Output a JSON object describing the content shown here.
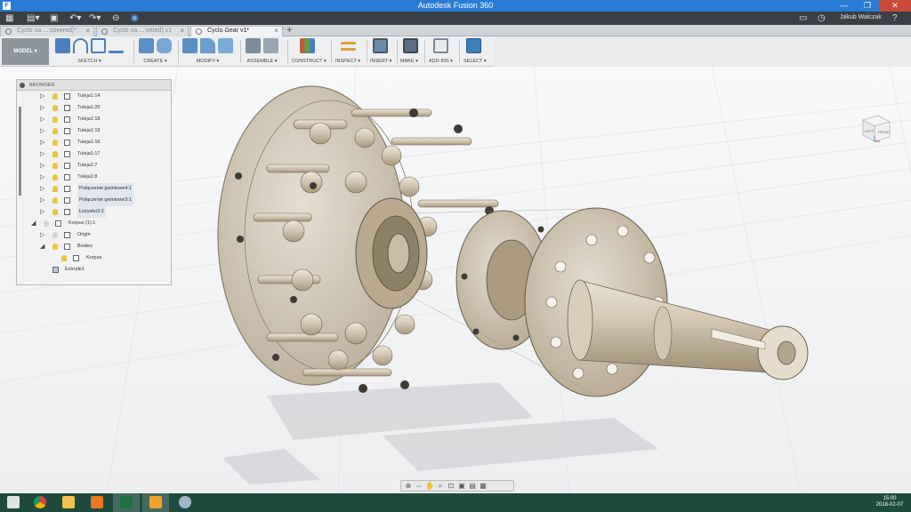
{
  "window": {
    "title": "Autodesk Fusion 360",
    "app_icon": "fusion-app-icon"
  },
  "quickbar": {
    "user": "Jakub Walczak",
    "icons": [
      "grid-icon",
      "file-icon",
      "save-icon",
      "undo-icon",
      "redo-icon",
      "sync-icon",
      "job-status-icon",
      "chat-icon",
      "clock-icon",
      "help-icon"
    ]
  },
  "tabs": [
    {
      "label": "Cyclo na ... covered)*",
      "active": false
    },
    {
      "label": "Cyclo na ... vered) v1",
      "active": false
    },
    {
      "label": "Cyclo Gear v1*",
      "active": true
    }
  ],
  "toolbar": {
    "workspace": "MODEL",
    "groups": [
      {
        "label": "SKETCH",
        "icons": [
          "sketch-icon",
          "arc-icon",
          "rectangle-icon",
          "line-icon"
        ]
      },
      {
        "label": "CREATE",
        "icons": [
          "extrude-icon",
          "revolve-icon"
        ]
      },
      {
        "label": "MODIFY",
        "icons": [
          "press-pull-icon",
          "fillet-icon",
          "chamfer-icon"
        ]
      },
      {
        "label": "ASSEMBLE",
        "icons": [
          "joint-icon",
          "component-icon"
        ]
      },
      {
        "label": "CONSTRUCT",
        "icons": [
          "plane-icon"
        ]
      },
      {
        "label": "INSPECT",
        "icons": [
          "measure-icon"
        ]
      },
      {
        "label": "INSERT",
        "icons": [
          "image-icon"
        ]
      },
      {
        "label": "MAKE",
        "icons": [
          "3d-print-icon"
        ]
      },
      {
        "label": "ADD-INS",
        "icons": [
          "scripts-icon"
        ]
      },
      {
        "label": "SELECT",
        "icons": [
          "select-icon"
        ]
      }
    ],
    "colors": {
      "sketch": "#4a7fbf",
      "create": "#5a8fc8",
      "modify": "#5b8ec4",
      "assemble": "#7e8d9c",
      "construct": "#c45a3a",
      "inspect": "#d8a13a",
      "insert": "#6a8aa8",
      "make": "#5a6f85",
      "addins": "#7a8898",
      "select": "#3c7fb8"
    }
  },
  "browser": {
    "title": "BROWSER",
    "items": [
      {
        "label": "Tuleja1:14",
        "indent": 1,
        "arrow": "▷"
      },
      {
        "label": "Tuleja1:20",
        "indent": 1,
        "arrow": "▷"
      },
      {
        "label": "Tuleja1:18",
        "indent": 1,
        "arrow": "▷"
      },
      {
        "label": "Tuleja1:19",
        "indent": 1,
        "arrow": "▷"
      },
      {
        "label": "Tuleja1:16",
        "indent": 1,
        "arrow": "▷"
      },
      {
        "label": "Tuleja1:17",
        "indent": 1,
        "arrow": "▷"
      },
      {
        "label": "Tuleja1:7",
        "indent": 1,
        "arrow": "▷"
      },
      {
        "label": "Tuleja1:8",
        "indent": 1,
        "arrow": "▷"
      },
      {
        "label": "Połączenie gwintowe4:1",
        "indent": 1,
        "arrow": "▷"
      },
      {
        "label": "Połączenie gwintowe3:1",
        "indent": 1,
        "arrow": "▷"
      },
      {
        "label": "Łożysko3:2",
        "indent": 1,
        "arrow": "▷"
      },
      {
        "label": "Korpus (1):1",
        "indent": 0,
        "arrow": "◢"
      },
      {
        "label": "Origin",
        "indent": 1,
        "arrow": "▷"
      },
      {
        "label": "Bodies",
        "indent": 1,
        "arrow": "◢"
      },
      {
        "label": "Korpus",
        "indent": 2,
        "arrow": ""
      },
      {
        "label": "Extrude1",
        "indent": 1,
        "arrow": ""
      }
    ]
  },
  "viewcube": {
    "left": "LEFT",
    "front": "FRONT"
  },
  "navbar": {
    "icons": [
      "orbit-icon",
      "pan-icon",
      "hand-icon",
      "zoom-icon",
      "fit-icon",
      "display-icon",
      "grid-settings-icon",
      "viewports-icon"
    ]
  },
  "taskbar": {
    "time": "15:00",
    "date": "2018-02-07",
    "apps": [
      "windows-start-icon",
      "chrome-icon",
      "file-explorer-icon",
      "media-player-icon",
      "excel-icon",
      "fusion360-icon",
      "paint-icon"
    ]
  }
}
